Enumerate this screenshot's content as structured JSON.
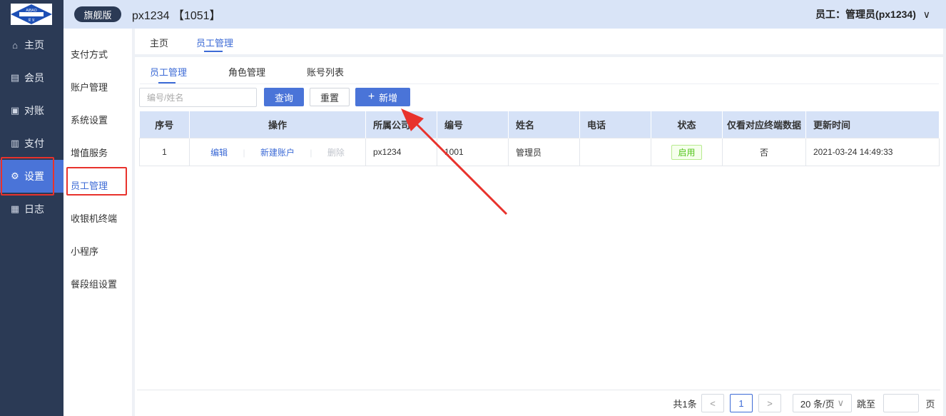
{
  "rail": {
    "logo_text": "AIBAO 爱宝",
    "items": [
      {
        "label": "主页",
        "icon": "home-icon"
      },
      {
        "label": "会员",
        "icon": "member-icon"
      },
      {
        "label": "对账",
        "icon": "reconcile-icon"
      },
      {
        "label": "支付",
        "icon": "payment-icon"
      },
      {
        "label": "设置",
        "icon": "gear-icon",
        "active": true
      },
      {
        "label": "日志",
        "icon": "log-icon"
      }
    ]
  },
  "header": {
    "edition": "旗舰版",
    "company": "px1234 【1051】",
    "user": "员工：管理员(px1234)"
  },
  "submenu": {
    "items": [
      "支付方式",
      "账户管理",
      "系统设置",
      "增值服务",
      "员工管理",
      "收银机终端",
      "小程序",
      "餐段组设置"
    ],
    "active": "员工管理"
  },
  "tabs": [
    "主页",
    "员工管理"
  ],
  "subtabs": [
    "员工管理",
    "角色管理",
    "账号列表"
  ],
  "search": {
    "placeholder": "编号/姓名",
    "value": ""
  },
  "buttons": {
    "query": "查询",
    "reset": "重置",
    "add": "新增"
  },
  "table": {
    "headers": [
      "序号",
      "操作",
      "所属公司",
      "编号",
      "姓名",
      "电话",
      "状态",
      "仅看对应终端数据",
      "更新时间"
    ],
    "rows": [
      {
        "index": "1",
        "ops": [
          "编辑",
          "新建账户",
          "删除"
        ],
        "company": "px1234",
        "code": "1001",
        "name": "管理员",
        "phone": "",
        "status": "启用",
        "terminal_only": "否",
        "updated": "2021-03-24 14:49:33"
      }
    ]
  },
  "pagination": {
    "total": "共1条",
    "current_page": "1",
    "page_size": "20 条/页",
    "goto_label": "跳至",
    "page_suffix": "页"
  },
  "colors": {
    "accent": "#4a74d8",
    "rail_bg": "#2b3a55",
    "annotation_red": "#e8322c",
    "status_green": "#52c41a"
  }
}
